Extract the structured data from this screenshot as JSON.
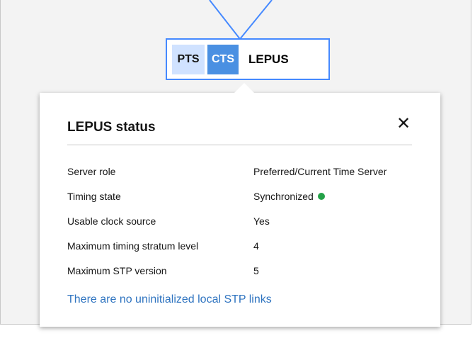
{
  "node": {
    "badges": [
      "PTS",
      "CTS"
    ],
    "name": "LEPUS",
    "border_color": "#4589ff",
    "cts_color": "#4a90e2",
    "pts_color": "#d0e2ff"
  },
  "popover": {
    "title": "LEPUS status",
    "close_icon": "close-icon",
    "rows": [
      {
        "label": "Server role",
        "value": "Preferred/Current Time Server"
      },
      {
        "label": "Timing state",
        "value": "Synchronized",
        "status_color": "#24a148"
      },
      {
        "label": "Usable clock source",
        "value": "Yes"
      },
      {
        "label": "Maximum timing stratum level",
        "value": "4"
      },
      {
        "label": "Maximum STP version",
        "value": "5"
      }
    ],
    "link_text": "There are no uninitialized local STP links",
    "link_color": "#2f74c0"
  }
}
